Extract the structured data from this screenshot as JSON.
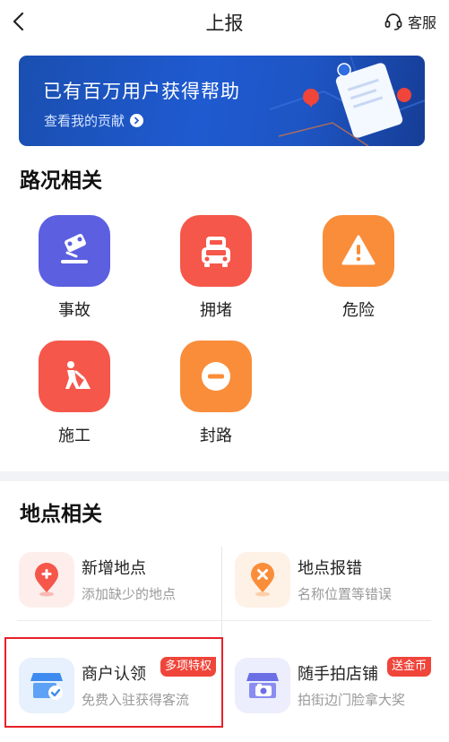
{
  "nav": {
    "title": "上报",
    "service_label": "客服"
  },
  "banner": {
    "title": "已有百万用户获得帮助",
    "link": "查看我的贡献"
  },
  "road_section": {
    "title": "路况相关",
    "items": [
      {
        "label": "事故",
        "icon": "accident-icon",
        "color": "#5b5fe0"
      },
      {
        "label": "拥堵",
        "icon": "congestion-icon",
        "color": "#f5574b"
      },
      {
        "label": "危险",
        "icon": "danger-icon",
        "color": "#f98d3a"
      },
      {
        "label": "施工",
        "icon": "construction-icon",
        "color": "#f5574b"
      },
      {
        "label": "封路",
        "icon": "road-closed-icon",
        "color": "#f98d3a"
      }
    ]
  },
  "place_section": {
    "title": "地点相关",
    "items": [
      {
        "title": "新增地点",
        "subtitle": "添加缺少的地点",
        "icon": "add-place-icon"
      },
      {
        "title": "地点报错",
        "subtitle": "名称位置等错误",
        "icon": "place-error-icon"
      },
      {
        "title": "商户认领",
        "subtitle": "免费入驻获得客流",
        "icon": "merchant-claim-icon",
        "tag": "多项特权"
      },
      {
        "title": "随手拍店铺",
        "subtitle": "拍街边门脸拿大奖",
        "icon": "shop-photo-icon",
        "tag": "送金币"
      }
    ]
  }
}
